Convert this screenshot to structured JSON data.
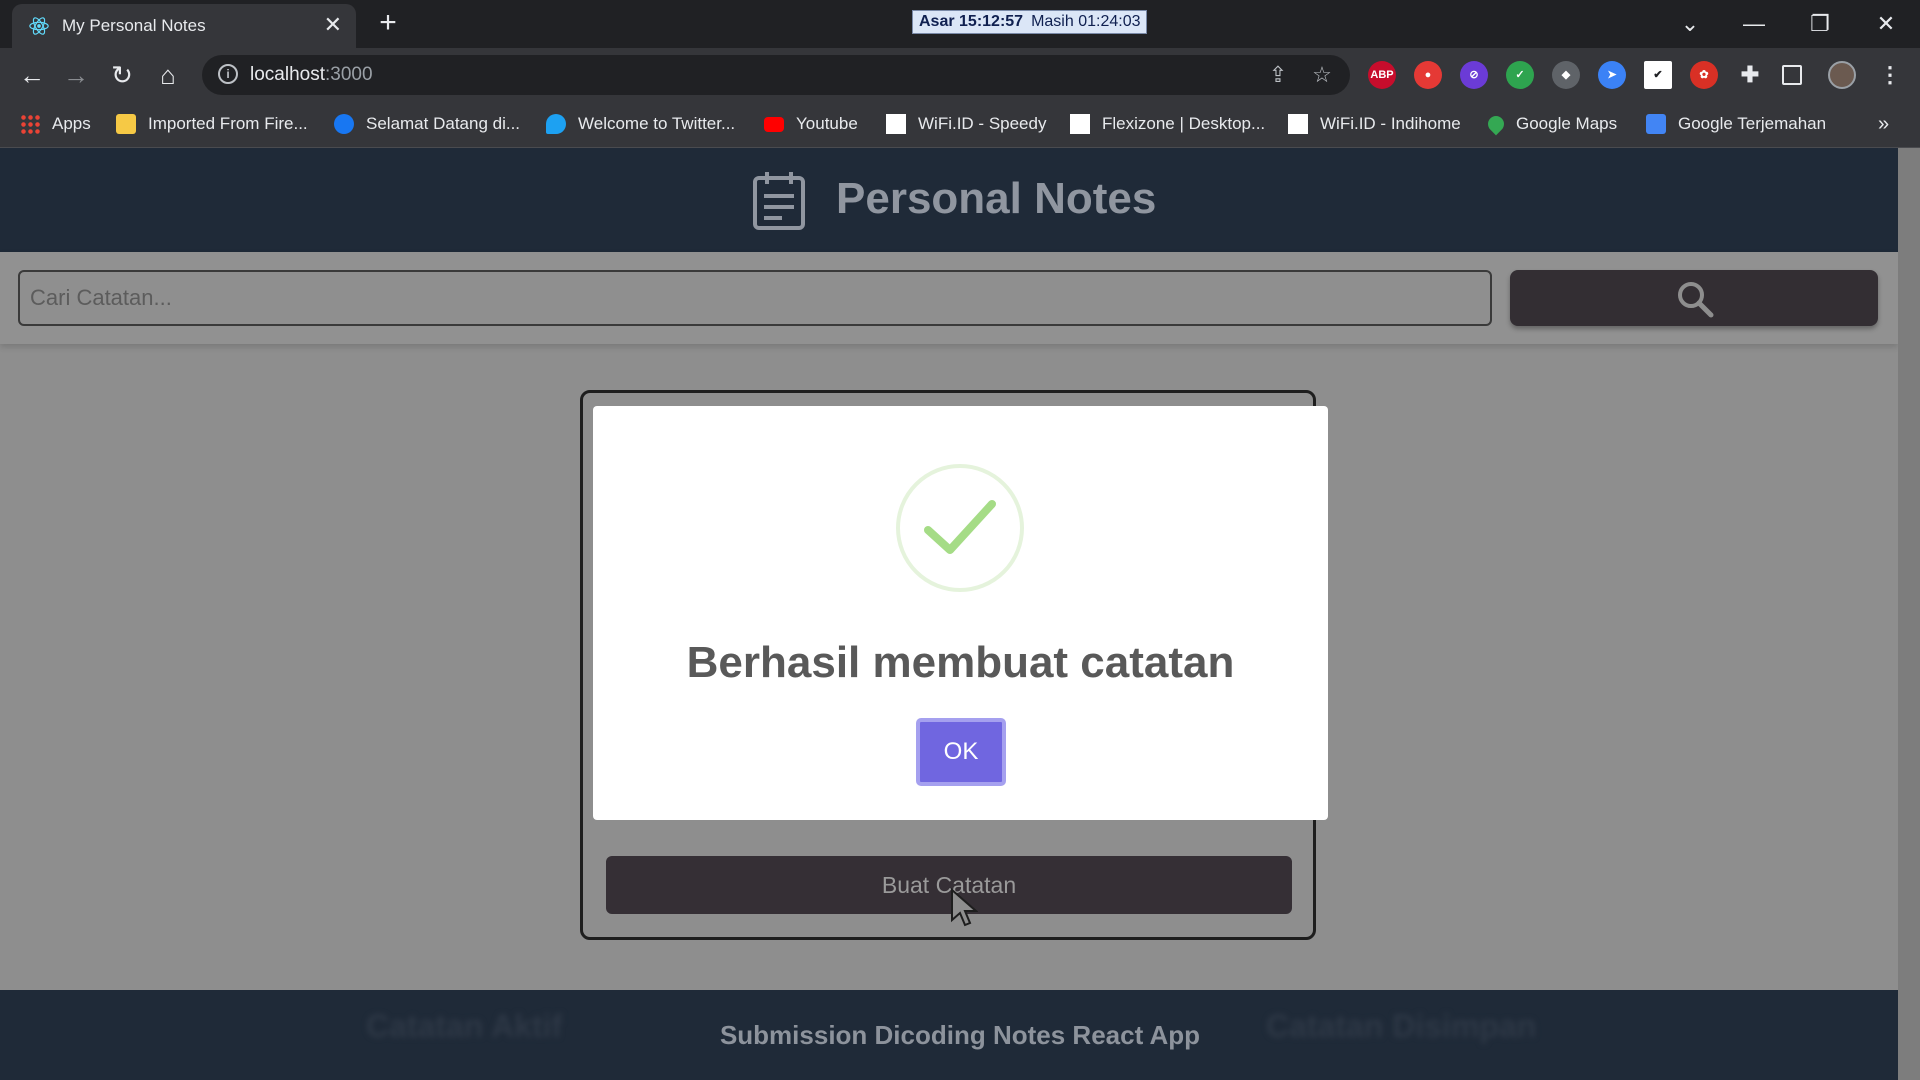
{
  "browser": {
    "tab_title": "My Personal Notes",
    "timer_prayer": "Asar 15:12:57",
    "timer_remaining": "Masih 01:24:03",
    "url_host": "localhost",
    "url_port": ":3000",
    "bookmarks": [
      {
        "label": "Apps",
        "color": "#ea4335"
      },
      {
        "label": "Imported From Fire...",
        "color": "#f6c945"
      },
      {
        "label": "Selamat Datang di...",
        "color": "#1877f2"
      },
      {
        "label": "Welcome to Twitter...",
        "color": "#1da1f2"
      },
      {
        "label": "Youtube",
        "color": "#ff0000"
      },
      {
        "label": "WiFi.ID - Speedy",
        "color": "#ffffff"
      },
      {
        "label": "Flexizone | Desktop...",
        "color": "#ffffff"
      },
      {
        "label": "WiFi.ID - Indihome",
        "color": "#ffffff"
      },
      {
        "label": "Google Maps",
        "color": "#34a853"
      },
      {
        "label": "Google Terjemahan",
        "color": "#4285f4"
      }
    ],
    "extensions": [
      {
        "name": "abp-icon",
        "text": "ABP",
        "color": "#c70d2c"
      },
      {
        "name": "shield-stop-icon",
        "text": "●",
        "color": "#e53935"
      },
      {
        "name": "block-icon",
        "text": "⊘",
        "color": "#6b3bd6"
      },
      {
        "name": "vpn-shield-icon",
        "text": "✓",
        "color": "#2ea44f"
      },
      {
        "name": "privacy-shield-icon",
        "text": "◆",
        "color": "#5f6368"
      },
      {
        "name": "cursor-ext-icon",
        "text": "➤",
        "color": "#3b82f6"
      },
      {
        "name": "checkbox-ext-icon",
        "text": "✔",
        "color": "#ffffff"
      },
      {
        "name": "gift-ext-icon",
        "text": "✿",
        "color": "#d93025"
      }
    ]
  },
  "app": {
    "title": "Personal Notes",
    "search_placeholder": "Cari Catatan...",
    "create_button": "Buat Catatan",
    "footer_left": "Catatan Aktif",
    "footer_right": "Catatan Disimpan",
    "footer_text": "Submission Dicoding Notes React App"
  },
  "modal": {
    "title": "Berhasil membuat catatan",
    "ok_label": "OK",
    "accent": "#7066e0",
    "success_color": "#a5dc86"
  }
}
